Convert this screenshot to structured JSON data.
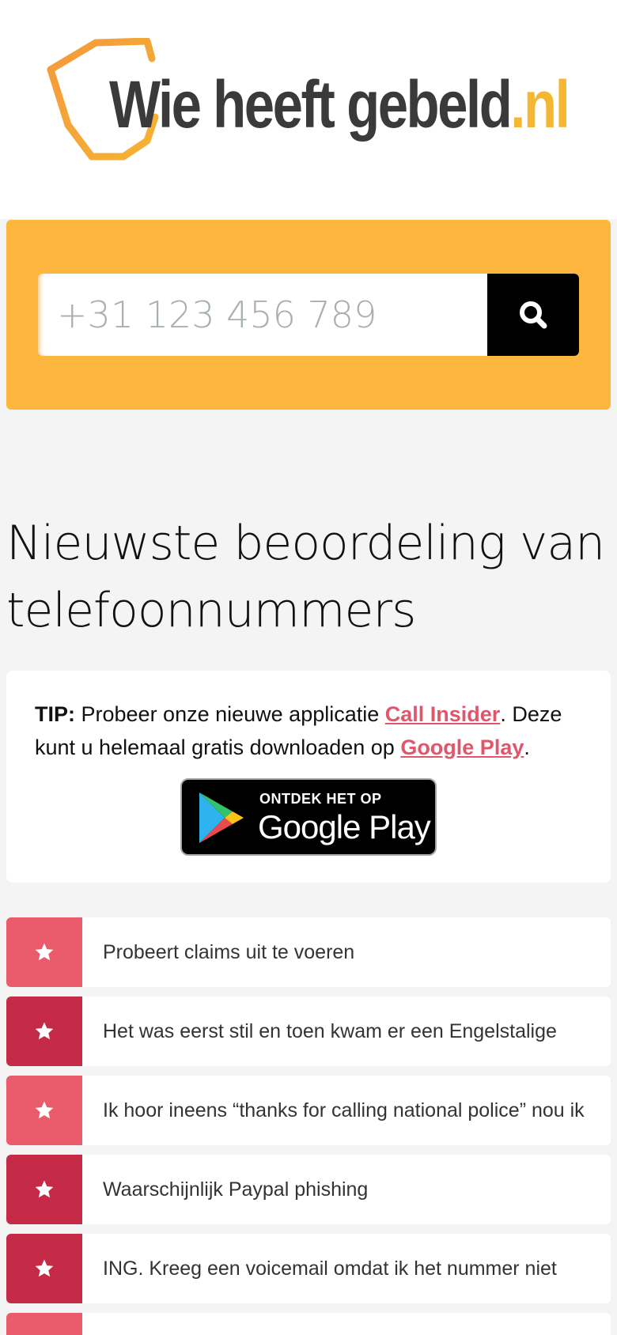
{
  "header": {
    "logo_main": "Wie heeft gebeld",
    "logo_tld": ".nl"
  },
  "search": {
    "placeholder": "+31 123 456 789",
    "icon": "search-icon"
  },
  "section": {
    "title": "Nieuwste beoordeling van telefoonnummers"
  },
  "tip": {
    "label": "TIP:",
    "text_before": " Probeer onze nieuwe applicatie ",
    "app_link": "Call Insider",
    "text_middle": ". Deze kunt u helemaal gratis downloaden op ",
    "store_link": "Google Play",
    "text_after": ".",
    "badge_small": "ONTDEK HET OP",
    "badge_big": "Google Play"
  },
  "reviews": [
    {
      "text": "Probeert claims uit te voeren",
      "icon": "star-icon"
    },
    {
      "text": "Het was eerst stil en toen kwam er een Engelstalige",
      "icon": "star-icon"
    },
    {
      "text": "Ik hoor ineens “thanks for calling national police” nou ik",
      "icon": "star-icon"
    },
    {
      "text": "Waarschijnlijk Paypal phishing",
      "icon": "star-icon"
    },
    {
      "text": "ING. Kreeg een voicemail omdat ik het nummer niet",
      "icon": "star-icon"
    },
    {
      "text": "",
      "icon": "star-icon"
    }
  ],
  "colors": {
    "accent": "#fdb73e",
    "link": "#e0566a",
    "badge_light": "#ea5b6c",
    "badge_dark": "#c52b47"
  }
}
